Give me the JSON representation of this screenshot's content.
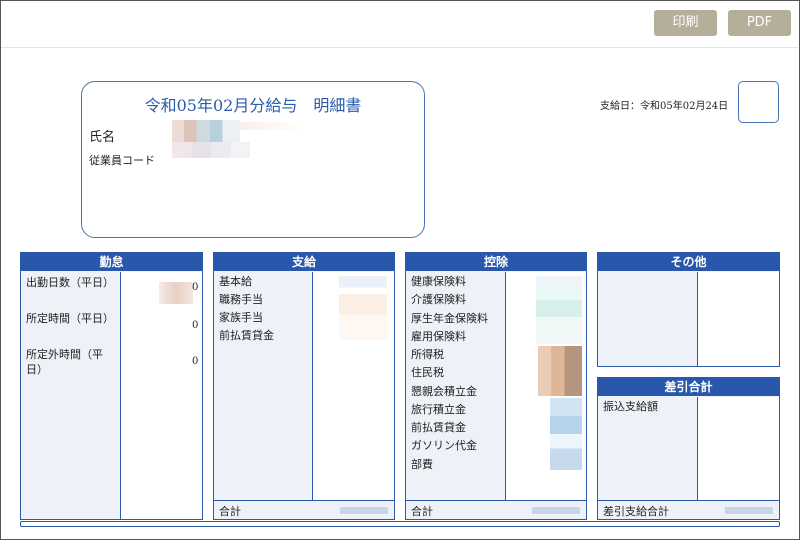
{
  "toolbar": {
    "print_label": "印刷",
    "pdf_label": "PDF"
  },
  "header": {
    "title": "令和05年02月分給与　明細書",
    "name_label": "氏名",
    "employee_code_label": "従業員コード",
    "pay_date": "支給日：令和05年02月24日"
  },
  "kintai": {
    "title": "勤怠",
    "items": [
      "出勤日数（平日）",
      "所定時間（平日）",
      "所定外時間（平日）"
    ],
    "digits": [
      "0",
      "0",
      "0"
    ]
  },
  "shikyu": {
    "title": "支給",
    "items": [
      "基本給",
      "職務手当",
      "家族手当",
      "前払賃貸金"
    ],
    "total_label": "合計"
  },
  "kojo": {
    "title": "控除",
    "items": [
      "健康保険料",
      "介護保険料",
      "厚生年金保険料",
      "雇用保険料",
      "所得税",
      "住民税",
      "懇親会積立金",
      "旅行積立金",
      "前払賃貸金",
      "ガソリン代金",
      "部費"
    ],
    "total_label": "合計"
  },
  "sonota": {
    "title": "その他"
  },
  "sashihiki": {
    "title": "差引合計",
    "transfer_label": "振込支給額",
    "total_label": "差引支給合計"
  },
  "colors": {
    "accent": "#2857ab",
    "button": "#b4ae9a",
    "panel_bg": "#eef1f7"
  }
}
